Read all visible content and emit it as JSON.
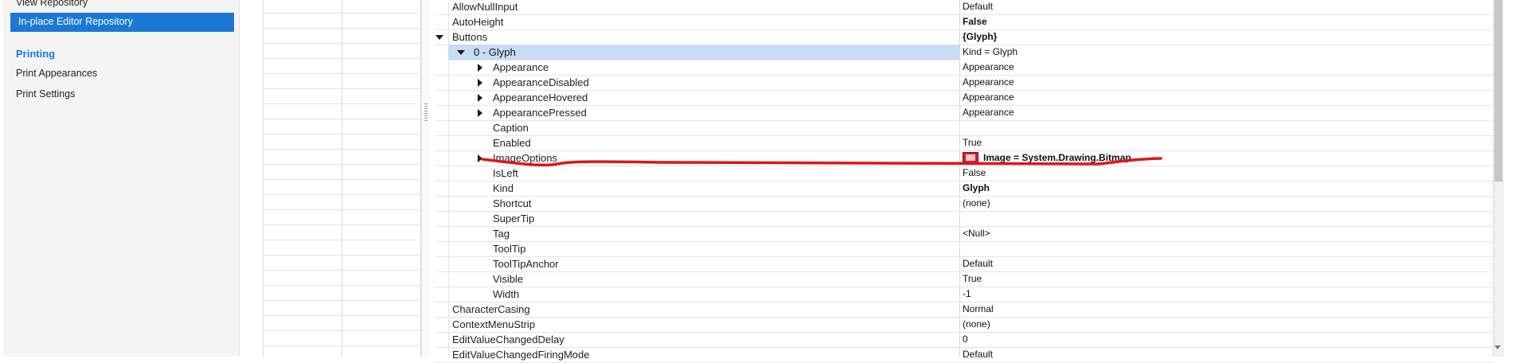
{
  "nav": {
    "items_top": [
      "View Repository"
    ],
    "selected": "In-place Editor Repository",
    "group_title": "Printing",
    "group_items": [
      "Print Appearances",
      "Print Settings"
    ],
    "accent_color": "#1b79d5"
  },
  "property_grid": {
    "rows": [
      {
        "name": "AllowNullInput",
        "value": "Default",
        "bold": false
      },
      {
        "name": "AutoHeight",
        "value": "False",
        "bold": true
      },
      {
        "name": "Buttons",
        "value": "{Glyph}",
        "bold": true,
        "expander": "down"
      },
      {
        "name": "0 - Glyph",
        "value": "Kind = Glyph",
        "bold": false,
        "expander": "down",
        "selected": true
      },
      {
        "name": "Appearance",
        "value": "Appearance",
        "bold": false,
        "expander": "right"
      },
      {
        "name": "AppearanceDisabled",
        "value": "Appearance",
        "bold": false,
        "expander": "right"
      },
      {
        "name": "AppearanceHovered",
        "value": "Appearance",
        "bold": false,
        "expander": "right"
      },
      {
        "name": "AppearancePressed",
        "value": "Appearance",
        "bold": false,
        "expander": "right"
      },
      {
        "name": "Caption",
        "value": "",
        "bold": false
      },
      {
        "name": "Enabled",
        "value": "True",
        "bold": false
      },
      {
        "name": "ImageOptions",
        "value": "Image = System.Drawing.Bitmap",
        "bold": true,
        "expander": "right",
        "icon": "broken-image-icon"
      },
      {
        "name": "IsLeft",
        "value": "False",
        "bold": false
      },
      {
        "name": "Kind",
        "value": "Glyph",
        "bold": true
      },
      {
        "name": "Shortcut",
        "value": "(none)",
        "bold": false
      },
      {
        "name": "SuperTip",
        "value": "",
        "bold": false
      },
      {
        "name": "Tag",
        "value": "<Null>",
        "bold": false
      },
      {
        "name": "ToolTip",
        "value": "",
        "bold": false
      },
      {
        "name": "ToolTipAnchor",
        "value": "Default",
        "bold": false
      },
      {
        "name": "Visible",
        "value": "True",
        "bold": false
      },
      {
        "name": "Width",
        "value": "-1",
        "bold": false
      },
      {
        "name": "CharacterCasing",
        "value": "Normal",
        "bold": false
      },
      {
        "name": "ContextMenuStrip",
        "value": "(none)",
        "bold": false
      },
      {
        "name": "EditValueChangedDelay",
        "value": "0",
        "bold": false
      },
      {
        "name": "EditValueChangedFiringMode",
        "value": "Default",
        "bold": false
      }
    ]
  },
  "colors": {
    "selection": "#c7ddf4",
    "annotation": "#e0141b"
  }
}
